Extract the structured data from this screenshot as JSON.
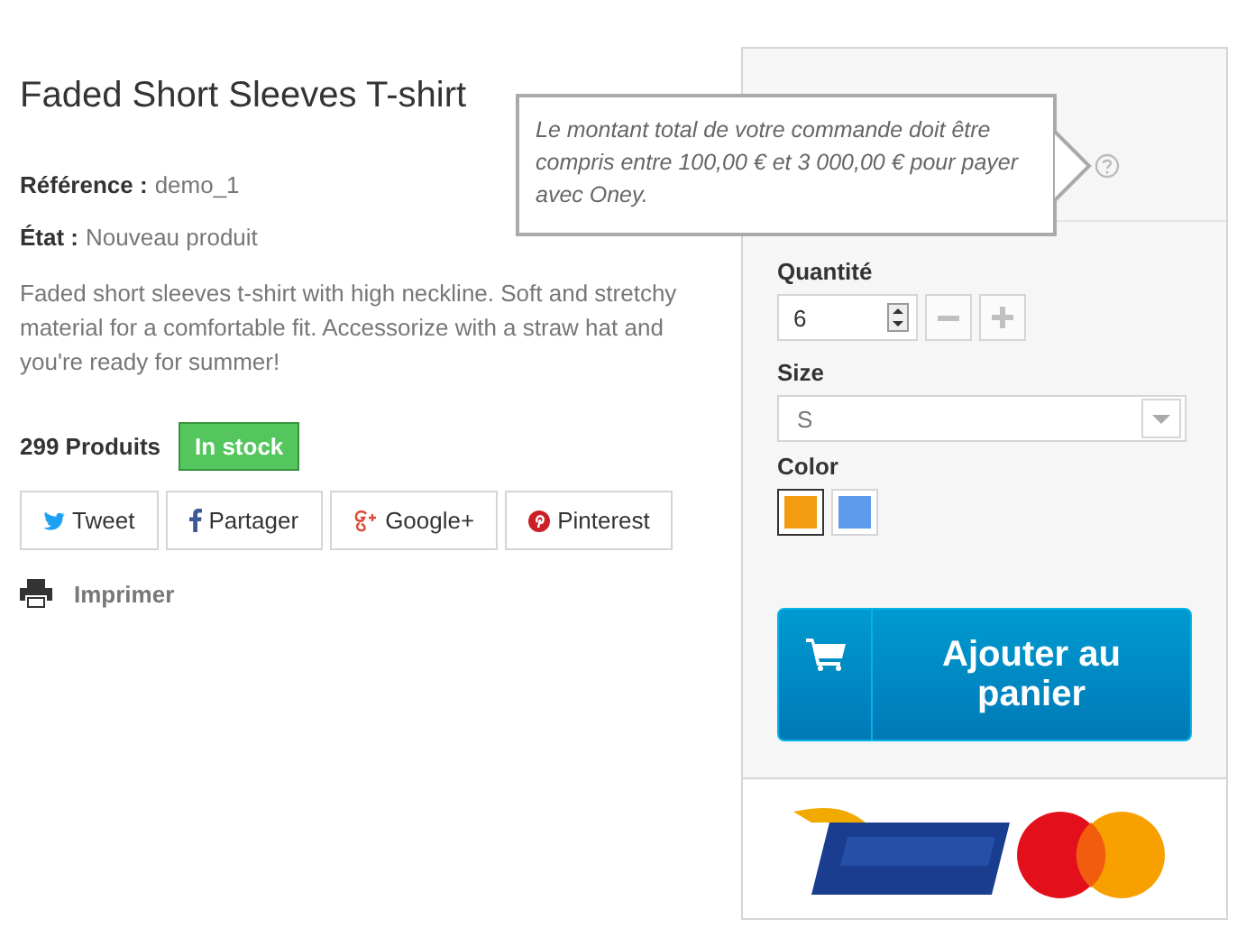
{
  "product": {
    "title": "Faded Short Sleeves T-shirt",
    "reference_label": "Référence :",
    "reference": "demo_1",
    "condition_label": "État :",
    "condition": "Nouveau produit",
    "description": "Faded short sleeves t-shirt with high neckline. Soft and stretchy material for a comfortable fit. Accessorize with a straw hat and you're ready for summer!",
    "quantity_count": "299 Produits",
    "stock_badge": "In stock"
  },
  "share_buttons": [
    {
      "kind": "twitter",
      "label": "Tweet"
    },
    {
      "kind": "facebook",
      "label": "Partager"
    },
    {
      "kind": "google",
      "label": "Google+"
    },
    {
      "kind": "pinterest",
      "label": "Pinterest"
    }
  ],
  "print_link": "Imprimer",
  "buy_box": {
    "tooltip": "Le montant total de votre commande doit être compris entre 100,00 € et 3 000,00 € pour payer avec Oney.",
    "quantity_label": "Quantité",
    "quantity": "6",
    "size_label": "Size",
    "size": "S",
    "color_label": "Color",
    "colors": [
      {
        "color": "#f39c11",
        "selected": true
      },
      {
        "color": "#5d9cec",
        "selected": false
      }
    ],
    "add_to_cart": "Ajouter au panier"
  }
}
